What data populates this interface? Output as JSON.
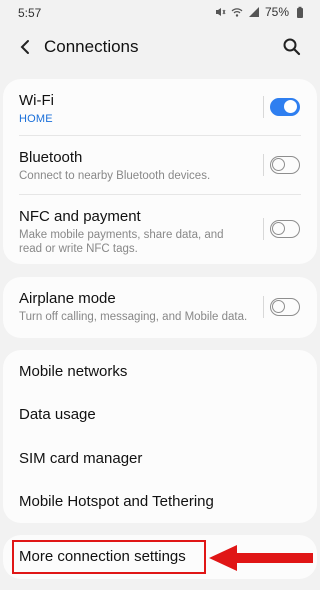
{
  "status": {
    "time": "5:57",
    "battery": "75%"
  },
  "header": {
    "title": "Connections"
  },
  "groups": {
    "wifi": {
      "label": "Wi-Fi",
      "sub": "HOME",
      "on": true
    },
    "bluetooth": {
      "label": "Bluetooth",
      "sub": "Connect to nearby Bluetooth devices.",
      "on": false
    },
    "nfc": {
      "label": "NFC and payment",
      "sub": "Make mobile payments, share data, and read or write NFC tags.",
      "on": false
    },
    "airplane": {
      "label": "Airplane mode",
      "sub": "Turn off calling, messaging, and Mobile data.",
      "on": false
    },
    "mobile_networks": {
      "label": "Mobile networks"
    },
    "data_usage": {
      "label": "Data usage"
    },
    "sim": {
      "label": "SIM card manager"
    },
    "hotspot": {
      "label": "Mobile Hotspot and Tethering"
    },
    "more": {
      "label": "More connection settings"
    }
  },
  "colors": {
    "accent": "#2f7ff0",
    "highlight": "#e01616"
  }
}
